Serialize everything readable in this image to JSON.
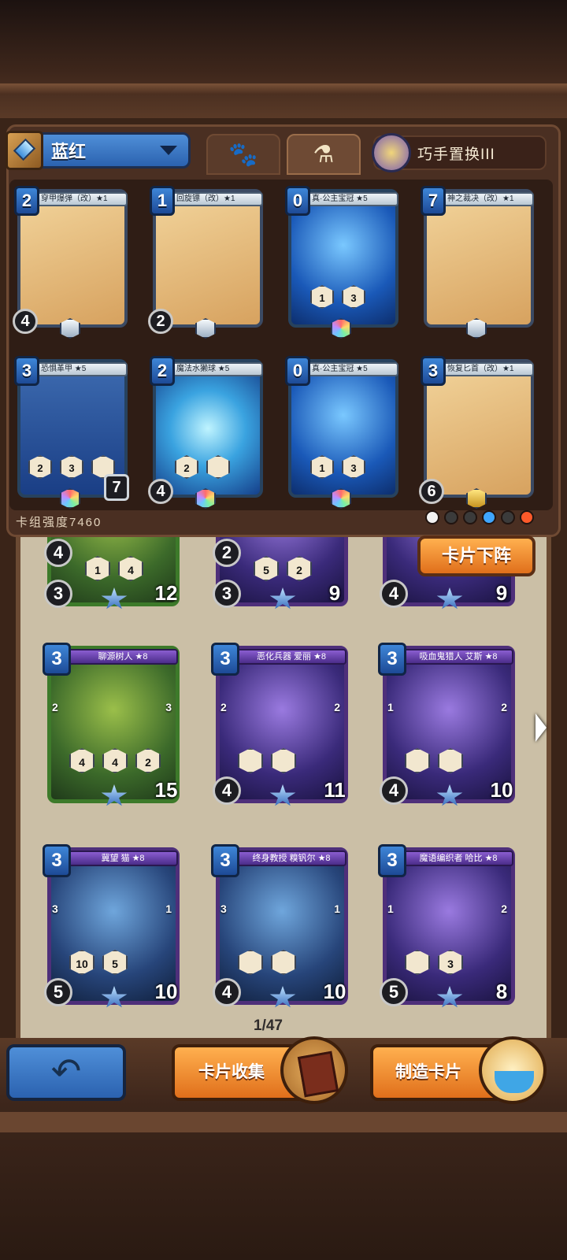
{
  "deck": {
    "name": "蓝红",
    "power_label": "卡组强度7460",
    "tab_paw": "🐾",
    "tab_potion": "⚗",
    "skill_name": "巧手置换III",
    "element_colors": [
      "#f2f2f2",
      "#3b3b3b",
      "#3b3b3b",
      "#3fa6ff",
      "#3b3b3b",
      "#ff5a2a"
    ]
  },
  "deck_cards": [
    {
      "name": "穿甲爆弹（改）★1",
      "cost": "2",
      "bomb": "4",
      "hp": "",
      "style": "gold",
      "hexes": []
    },
    {
      "name": "回旋镖（改）★1",
      "cost": "1",
      "bomb": "2",
      "hp": "",
      "style": "gold",
      "hexes": []
    },
    {
      "name": "真·公主宝冠 ★5",
      "cost": "0",
      "bomb": "",
      "hp": "",
      "style": "blue",
      "hexes": [
        "1",
        "3"
      ]
    },
    {
      "name": "神之裁决（改）★1",
      "cost": "7",
      "bomb": "",
      "hp": "",
      "style": "gold",
      "hexes": []
    },
    {
      "name": "恐惧革甲 ★5",
      "cost": "3",
      "bomb": "",
      "hp": "7",
      "style": "armor",
      "hexes": [
        "2",
        "3",
        ""
      ]
    },
    {
      "name": "魔法水獭球 ★5",
      "cost": "2",
      "bomb": "4",
      "hp": "",
      "style": "teal",
      "hexes": [
        "2",
        ""
      ]
    },
    {
      "name": "真·公主宝冠 ★5",
      "cost": "0",
      "bomb": "",
      "hp": "",
      "style": "blue",
      "hexes": [
        "1",
        "3"
      ]
    },
    {
      "name": "恢复匕首（改）★1",
      "cost": "3",
      "bomb": "6",
      "hp": "",
      "style": "gold",
      "hexes": []
    }
  ],
  "unset_button": "卡片下阵",
  "partial_cards": [
    {
      "cost_top": "4",
      "h1": "1",
      "h2": "4",
      "atk": "3",
      "life": "12"
    },
    {
      "cost_top": "2",
      "h1": "5",
      "h2": "2",
      "atk": "3",
      "life": "9"
    },
    {
      "cost_top": "",
      "h1": "",
      "h2": "",
      "atk": "4",
      "life": "9"
    }
  ],
  "collection_cards": [
    {
      "name": "聊源树人 ★8",
      "cost": "3",
      "style": "green",
      "side_left": "2",
      "side_right": "3",
      "h1": "4",
      "h2": "4",
      "h3": "2",
      "atk": "",
      "life": "15"
    },
    {
      "name": "恶化兵器 爱丽 ★8",
      "cost": "3",
      "style": "purple",
      "side_left": "2",
      "side_right": "2",
      "h1": "",
      "h2": "",
      "h3": "",
      "atk": "4",
      "life": "11"
    },
    {
      "name": "吸血鬼猎人 艾斯 ★8",
      "cost": "3",
      "style": "purple",
      "side_left": "1",
      "side_right": "2",
      "h1": "",
      "h2": "",
      "h3": "",
      "atk": "4",
      "life": "10"
    },
    {
      "name": "冀望 猫 ★8",
      "cost": "3",
      "style": "bluep",
      "side_left": "3",
      "side_right": "1",
      "h1": "10",
      "h2": "5",
      "h3": "",
      "atk": "5",
      "life": "10"
    },
    {
      "name": "终身教授 糗钒尔 ★8",
      "cost": "3",
      "style": "bluep",
      "side_left": "3",
      "side_right": "1",
      "h1": "",
      "h2": "",
      "h3": "",
      "atk": "4",
      "life": "10"
    },
    {
      "name": "魔语编织者 哈比 ★8",
      "cost": "3",
      "style": "purple",
      "side_left": "1",
      "side_right": "2",
      "h1": "",
      "h2": "3",
      "h3": "",
      "atk": "5",
      "life": "8"
    }
  ],
  "pager": "1/47",
  "buttons": {
    "back": "↶",
    "collect": "卡片收集",
    "craft": "制造卡片"
  }
}
